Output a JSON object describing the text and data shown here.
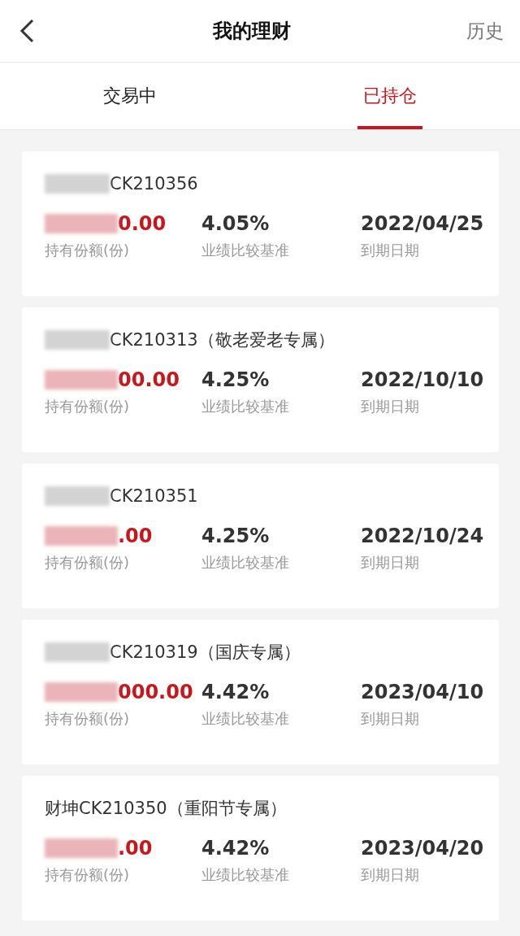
{
  "header": {
    "title": "我的理财",
    "history": "历史"
  },
  "tabs": [
    {
      "label": "交易中",
      "selected": false
    },
    {
      "label": "已持仓",
      "selected": true
    }
  ],
  "holdings": [
    {
      "name": "CK210356",
      "name_redacted": true,
      "amount": "0.00",
      "amount_redacted": true,
      "amount_label": "持有份额(份)",
      "rate": "4.05%",
      "rate_label": "业绩比较基准",
      "date": "2022/04/25",
      "date_label": "到期日期"
    },
    {
      "name": "CK210313（敬老爱老专属）",
      "name_redacted": true,
      "amount": "00.00",
      "amount_redacted": true,
      "amount_label": "持有份额(份)",
      "rate": "4.25%",
      "rate_label": "业绩比较基准",
      "date": "2022/10/10",
      "date_label": "到期日期"
    },
    {
      "name": "CK210351",
      "name_redacted": true,
      "amount": ".00",
      "amount_redacted": true,
      "amount_label": "持有份额(份)",
      "rate": "4.25%",
      "rate_label": "业绩比较基准",
      "date": "2022/10/24",
      "date_label": "到期日期"
    },
    {
      "name": "CK210319（国庆专属）",
      "name_redacted": true,
      "amount": "000.00",
      "amount_redacted": true,
      "amount_label": "持有份额(份)",
      "rate": "4.42%",
      "rate_label": "业绩比较基准",
      "date": "2023/04/10",
      "date_label": "到期日期"
    },
    {
      "name": "财坤CK210350（重阳节专属）",
      "name_redacted": false,
      "amount": ".00",
      "amount_redacted": true,
      "amount_label": "持有份额(份)",
      "rate": "4.42%",
      "rate_label": "业绩比较基准",
      "date": "2023/04/20",
      "date_label": "到期日期"
    }
  ]
}
